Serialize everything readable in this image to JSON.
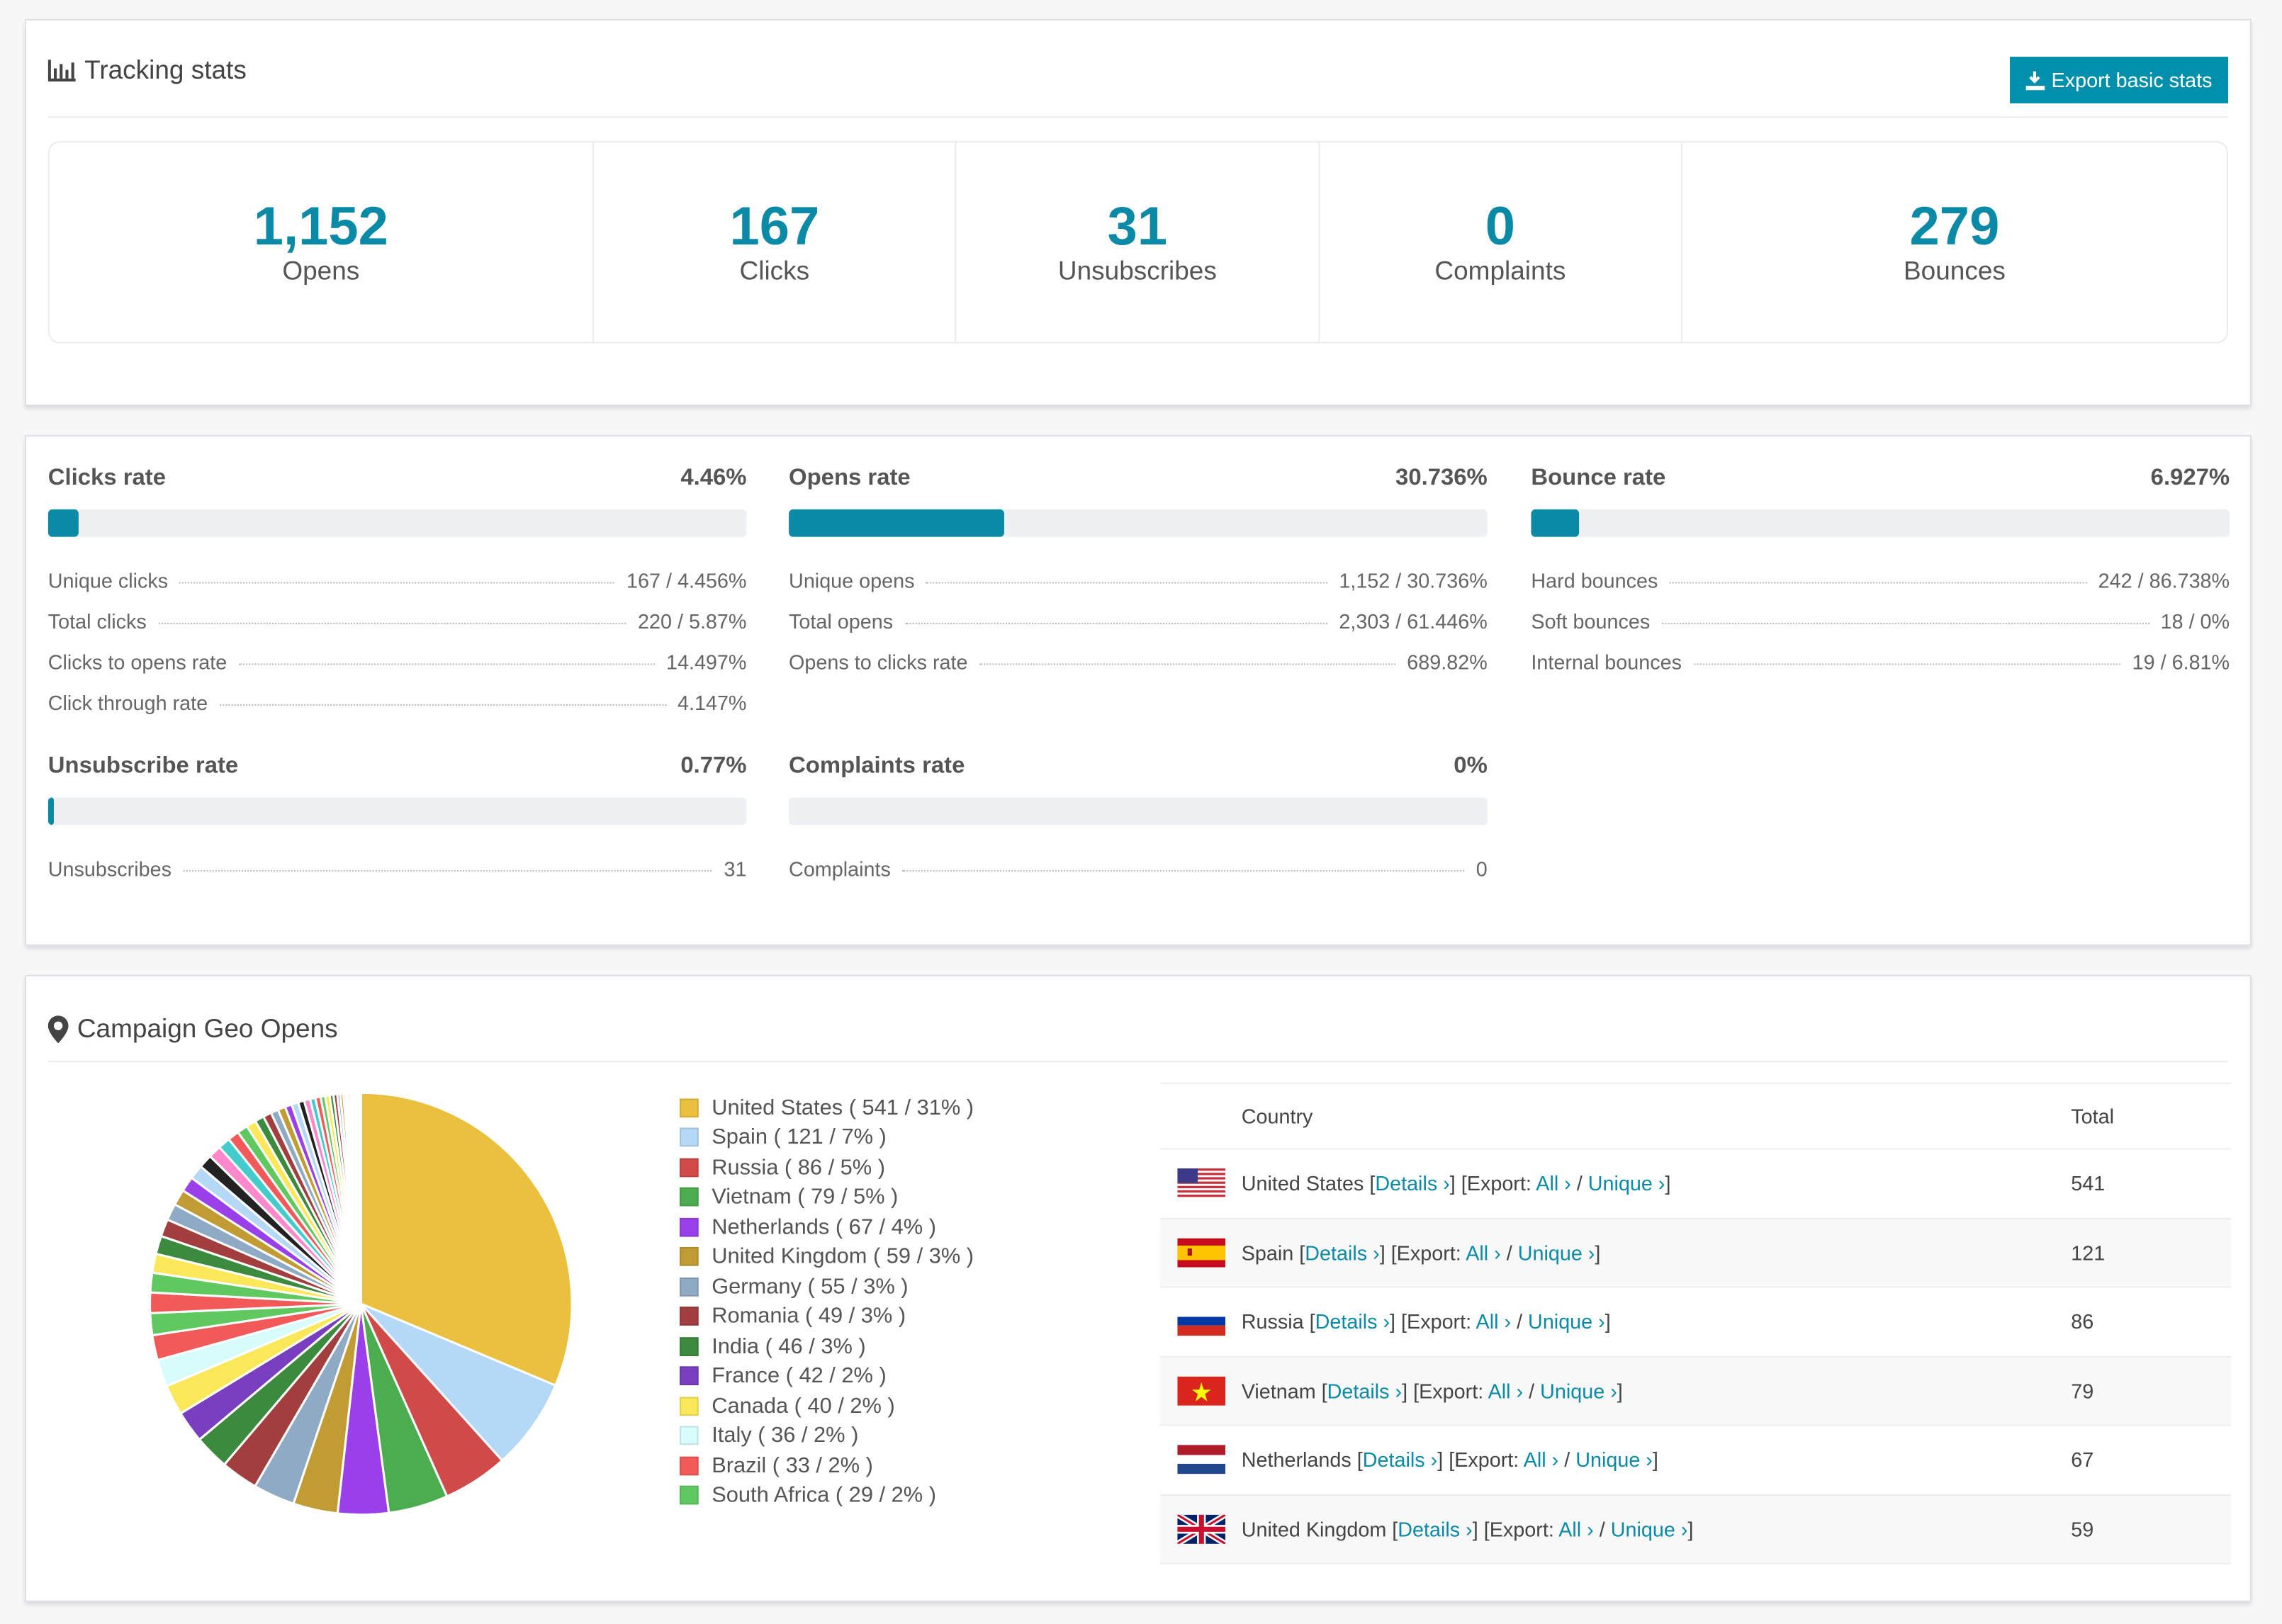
{
  "tracking": {
    "title": "Tracking stats",
    "title_icon": "bar-chart-icon",
    "export_label": "Export basic stats",
    "export_icon": "download-icon",
    "stats": [
      {
        "value": "1,152",
        "label": "Opens"
      },
      {
        "value": "167",
        "label": "Clicks"
      },
      {
        "value": "31",
        "label": "Unsubscribes"
      },
      {
        "value": "0",
        "label": "Complaints"
      },
      {
        "value": "279",
        "label": "Bounces"
      }
    ]
  },
  "rates": [
    {
      "title": "Clicks rate",
      "value": "4.46%",
      "percent": 4.46,
      "rows": [
        {
          "label": "Unique clicks",
          "value": "167 / 4.456%"
        },
        {
          "label": "Total clicks",
          "value": "220 / 5.87%"
        },
        {
          "label": "Clicks to opens rate",
          "value": "14.497%"
        },
        {
          "label": "Click through rate",
          "value": "4.147%"
        }
      ]
    },
    {
      "title": "Opens rate",
      "value": "30.736%",
      "percent": 30.736,
      "rows": [
        {
          "label": "Unique opens",
          "value": "1,152 / 30.736%"
        },
        {
          "label": "Total opens",
          "value": "2,303 / 61.446%"
        },
        {
          "label": "Opens to clicks rate",
          "value": "689.82%"
        }
      ]
    },
    {
      "title": "Bounce rate",
      "value": "6.927%",
      "percent": 6.927,
      "rows": [
        {
          "label": "Hard bounces",
          "value": "242 / 86.738%"
        },
        {
          "label": "Soft bounces",
          "value": "18 / 0%"
        },
        {
          "label": "Internal bounces",
          "value": "19 / 6.81%"
        }
      ]
    },
    {
      "title": "Unsubscribe rate",
      "value": "0.77%",
      "percent": 0.77,
      "rows": [
        {
          "label": "Unsubscribes",
          "value": "31"
        }
      ]
    },
    {
      "title": "Complaints rate",
      "value": "0%",
      "percent": 0,
      "rows": [
        {
          "label": "Complaints",
          "value": "0"
        }
      ]
    }
  ],
  "geo": {
    "title": "Campaign Geo Opens",
    "title_icon": "map-marker-icon",
    "table": {
      "headers": [
        "Country",
        "Total"
      ],
      "details_label": "Details ›",
      "export_label": "Export:",
      "all_label": "All ›",
      "unique_label": "Unique ›",
      "rows": [
        {
          "country": "United States",
          "total": "541",
          "flag": "us"
        },
        {
          "country": "Spain",
          "total": "121",
          "flag": "es"
        },
        {
          "country": "Russia",
          "total": "86",
          "flag": "ru"
        },
        {
          "country": "Vietnam",
          "total": "79",
          "flag": "vn"
        },
        {
          "country": "Netherlands",
          "total": "67",
          "flag": "nl"
        },
        {
          "country": "United Kingdom",
          "total": "59",
          "flag": "gb"
        },
        {
          "country": "",
          "total": "",
          "flag": "de"
        }
      ]
    }
  },
  "chart_data": {
    "type": "pie",
    "start": "top",
    "direction": "clockwise",
    "slices": [
      {
        "label": "United States ( 541 / 31% )",
        "value": 541,
        "color": "#ebc03f"
      },
      {
        "label": "Spain ( 121 / 7% )",
        "value": 121,
        "color": "#b4d8f6"
      },
      {
        "label": "Russia ( 86 / 5% )",
        "value": 86,
        "color": "#d14a4a"
      },
      {
        "label": "Vietnam ( 79 / 5% )",
        "value": 79,
        "color": "#4cad50"
      },
      {
        "label": "Netherlands ( 67 / 4% )",
        "value": 67,
        "color": "#9a40ea"
      },
      {
        "label": "United Kingdom ( 59 / 3% )",
        "value": 59,
        "color": "#c19b34"
      },
      {
        "label": "Germany ( 55 / 3% )",
        "value": 55,
        "color": "#8eaac4"
      },
      {
        "label": "Romania ( 49 / 3% )",
        "value": 49,
        "color": "#a33e3e"
      },
      {
        "label": "India ( 46 / 3% )",
        "value": 46,
        "color": "#3b8a3e"
      },
      {
        "label": "France ( 42 / 2% )",
        "value": 42,
        "color": "#7a3ec0"
      },
      {
        "label": "Canada ( 40 / 2% )",
        "value": 40,
        "color": "#fbe85a"
      },
      {
        "label": "Italy ( 36 / 2% )",
        "value": 36,
        "color": "#d8fbfb"
      },
      {
        "label": "Brazil ( 33 / 2% )",
        "value": 33,
        "color": "#f25a5a"
      },
      {
        "label": "South Africa ( 29 / 2% )",
        "value": 29,
        "color": "#5fc95f"
      }
    ],
    "unlabeled_slices": [
      27,
      26,
      25,
      24,
      23,
      22,
      21,
      20,
      19,
      18,
      17,
      16,
      15,
      14,
      13,
      12,
      11,
      10,
      10,
      9,
      9,
      8,
      8,
      7,
      7,
      6,
      6,
      5,
      5,
      4,
      4,
      3,
      3,
      3,
      2,
      2,
      2,
      2,
      1,
      1,
      1,
      1,
      1,
      1
    ],
    "legend": "right"
  }
}
